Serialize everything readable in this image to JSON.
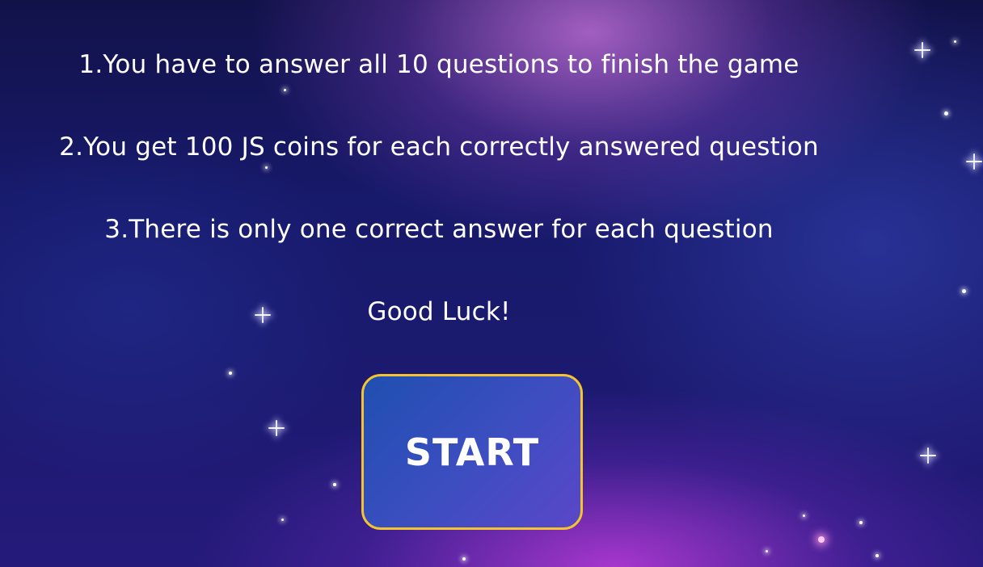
{
  "rules": {
    "items": [
      "1.You have to answer all 10 questions to finish the game",
      "2.You get 100 JS coins for each correctly answered question",
      "3.There is only one correct answer for each question"
    ],
    "closing": "Good Luck!"
  },
  "start_button": {
    "label": "START",
    "border_color": "#f4c430"
  },
  "colors": {
    "background": "#17196a",
    "text": "#ffffff",
    "accent": "#f4c430"
  }
}
